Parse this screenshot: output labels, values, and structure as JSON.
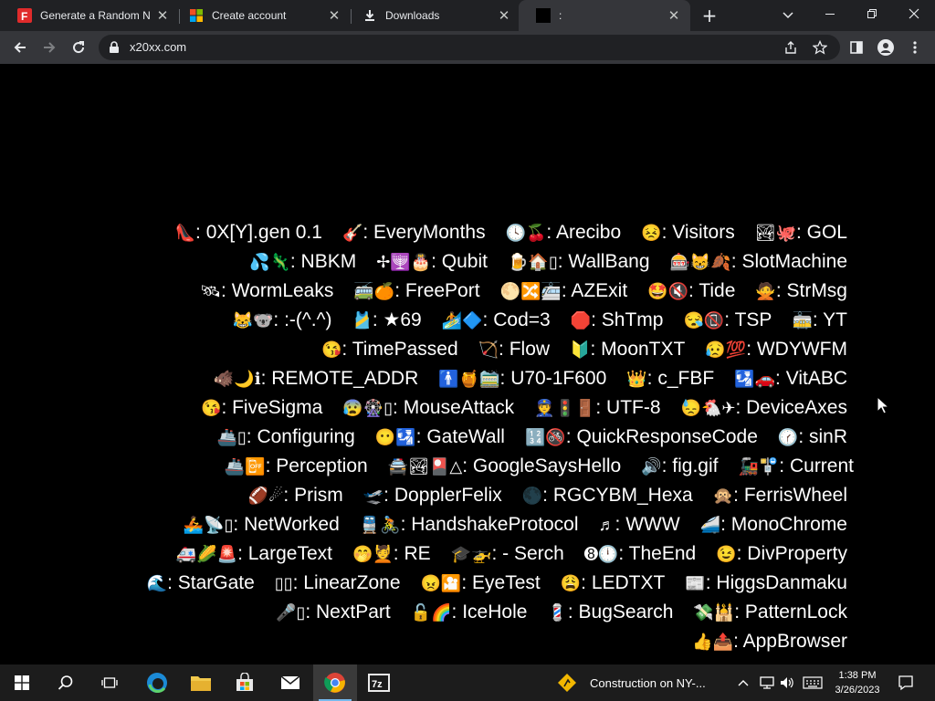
{
  "browser": {
    "tabs": [
      {
        "title": "Generate a Random Na",
        "favicon": "letter-f-icon",
        "favicon_color": "#e02b2b"
      },
      {
        "title": "Create account",
        "favicon": "microsoft-logo-icon"
      },
      {
        "title": "Downloads",
        "favicon": "download-icon"
      },
      {
        "title": ":",
        "favicon": "black-square-icon",
        "active": true
      }
    ],
    "url": "x20xx.com"
  },
  "page": {
    "lines": [
      [
        [
          "👠",
          "0X[Y].gen 0.1"
        ],
        [
          "🎸",
          "EveryMonths"
        ],
        [
          "🕓🍒",
          "Arecibo"
        ],
        [
          "😣",
          "Visitors"
        ],
        [
          "🏞🐙",
          "GOL"
        ]
      ],
      [
        [
          "💦🦎",
          "NBKM"
        ],
        [
          "✢🕎🎂",
          "Qubit"
        ],
        [
          "🍺🏠▯",
          "WallBang"
        ],
        [
          "🎰😸🍂",
          "SlotMachine"
        ]
      ],
      [
        [
          "🛰",
          "WormLeaks"
        ],
        [
          "🚎🍊",
          "FreePort"
        ],
        [
          "🌕🔀🚈",
          "AZExit"
        ],
        [
          "🤩🔇",
          "Tide"
        ],
        [
          "🙅",
          "StrMsg"
        ]
      ],
      [
        [
          "😹🐨",
          ":-(^.^)"
        ],
        [
          "🎽",
          "★69"
        ],
        [
          "🏄🔷",
          "Cod=3"
        ],
        [
          "🛑",
          "ShTmp"
        ],
        [
          "😪📵",
          "TSP"
        ],
        [
          "🚋",
          "YT"
        ]
      ],
      [
        [
          "😘",
          "TimePassed"
        ],
        [
          "🏹",
          "Flow"
        ],
        [
          "🔰",
          "MoonTXT"
        ],
        [
          "😥💯",
          "WDYWFM"
        ]
      ],
      [
        [
          "🐗🌙ℹ",
          "REMOTE_ADDR"
        ],
        [
          "🚹🍯🚞",
          "U70-1F600"
        ],
        [
          "👑",
          "c_FBF"
        ],
        [
          "🛂🚗",
          "VitABC"
        ]
      ],
      [
        [
          "😘",
          "FiveSigma"
        ],
        [
          "😰🎡▯",
          "MouseAttack"
        ],
        [
          "👮🚦🚪",
          "UTF-8"
        ],
        [
          "😓🐔✈",
          "DeviceAxes"
        ]
      ],
      [
        [
          "🚢▯",
          "Configuring"
        ],
        [
          "😶🛂",
          "GateWall"
        ],
        [
          "🔢🚳",
          "QuickResponseCode"
        ],
        [
          "🕜",
          "sinR"
        ]
      ],
      [
        [
          "🚢📴",
          "Perception"
        ],
        [
          "🚔🏞🎴△",
          "GoogleSaysHello"
        ],
        [
          "🔊",
          "fig.gif"
        ],
        [
          "🚂🚏",
          "Current"
        ]
      ],
      [
        [
          "🏈☄",
          "Prism"
        ],
        [
          "🛫",
          "DopplerFelix"
        ],
        [
          "🌑",
          "RGCYBM_Hexa"
        ],
        [
          "🙊",
          "FerrisWheel"
        ]
      ],
      [
        [
          "🚣📡▯",
          "NetWorked"
        ],
        [
          "🚆🚴",
          "HandshakeProtocol"
        ],
        [
          "♬",
          "WWW"
        ],
        [
          "🚄",
          "MonoChrome"
        ]
      ],
      [
        [
          "🚑🌽🚨",
          "LargeText"
        ],
        [
          "🤭💆",
          "RE"
        ],
        [
          "🎓🚁",
          "- Serch"
        ],
        [
          "➑🕛",
          "TheEnd"
        ],
        [
          "😉",
          "DivProperty"
        ]
      ],
      [
        [
          "🌊",
          "StarGate"
        ],
        [
          "▯▯",
          "LinearZone"
        ],
        [
          "😠🎦",
          "EyeTest"
        ],
        [
          "😩",
          "LEDTXT"
        ],
        [
          "📰",
          "HiggsDanmaku"
        ]
      ],
      [
        [
          "🎤▯",
          "NextPart"
        ],
        [
          "🔓🌈",
          "IceHole"
        ],
        [
          "💈",
          "BugSearch"
        ],
        [
          "💸🕌",
          "PatternLock"
        ]
      ],
      [
        [
          "👍📤",
          "AppBrowser"
        ]
      ]
    ]
  },
  "taskbar": {
    "icons": [
      "windows-start-icon",
      "search-icon",
      "task-view-icon",
      "edge-icon",
      "file-explorer-icon",
      "microsoft-store-icon",
      "mail-icon",
      "chrome-icon",
      "7zip-icon"
    ],
    "weather_text": "Construction on NY-...",
    "time": "1:38 PM",
    "date": "3/26/2023"
  }
}
